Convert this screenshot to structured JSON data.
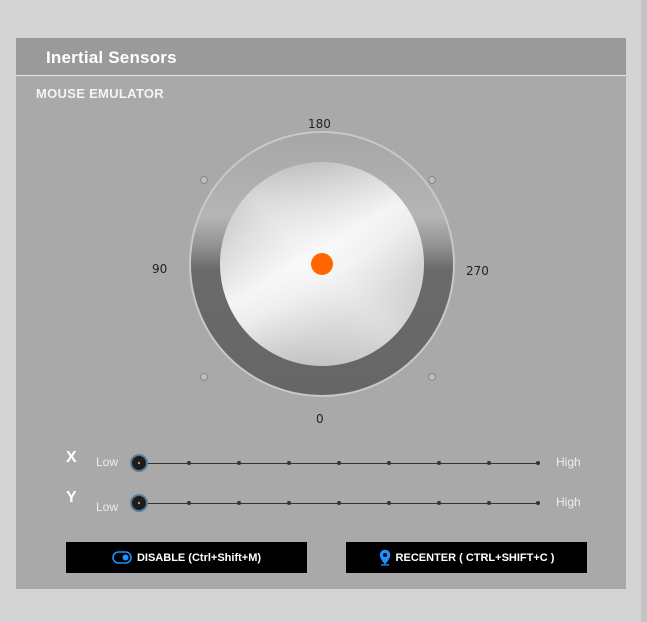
{
  "panel": {
    "title": "Inertial Sensors"
  },
  "section": {
    "title": "MOUSE EMULATOR"
  },
  "dial": {
    "labels": {
      "top": "180",
      "left": "90",
      "right": "270",
      "bottom": "0"
    },
    "indicator_color": "#ff6600"
  },
  "sliders": [
    {
      "axis": "X",
      "low_label": "Low",
      "high_label": "High",
      "value": 0
    },
    {
      "axis": "Y",
      "low_label": "Low",
      "high_label": "High",
      "value": 0
    }
  ],
  "buttons": {
    "disable": {
      "label": "DISABLE (Ctrl+Shift+M)",
      "icon": "toggle-icon"
    },
    "recenter": {
      "label": "RECENTER ( CTRL+SHIFT+C )",
      "icon": "location-pin-icon"
    }
  },
  "colors": {
    "accent": "#1e90ff",
    "indicator": "#ff6600",
    "button_bg": "#000000"
  }
}
